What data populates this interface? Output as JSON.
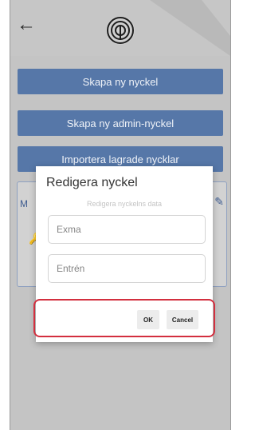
{
  "header": {
    "back_icon": "arrow-left-icon",
    "logo_icon": "fingerprint-logo-icon"
  },
  "buttons": [
    {
      "label": "Skapa ny nyckel"
    },
    {
      "label": "Skapa ny admin-nyckel"
    },
    {
      "label": "Importera lagrade nycklar"
    }
  ],
  "card": {
    "label_initial": "M",
    "key_icon": "key-icon",
    "edit_icon": "edit-pencil-icon"
  },
  "dialog": {
    "title": "Redigera nyckel",
    "subtitle": "Redigera nyckelns data",
    "fields": [
      {
        "placeholder": "Exma"
      },
      {
        "placeholder": "Entrén"
      }
    ],
    "ok_label": "OK",
    "cancel_label": "Cancel"
  },
  "colors": {
    "accent_button": "#5677a8",
    "highlight_border": "#d32f3f"
  }
}
